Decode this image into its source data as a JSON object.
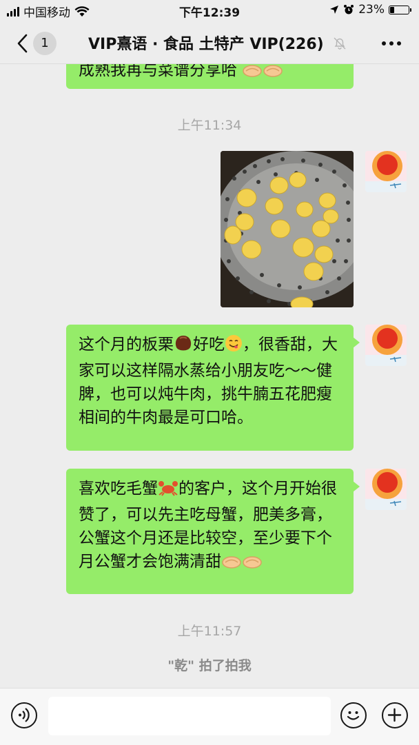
{
  "status_bar": {
    "carrier": "中国移动",
    "time": "下午12:39",
    "battery": "23%"
  },
  "nav": {
    "back_count": "1",
    "title": "VIP熹语 · 食品 土特产 VIP(226)"
  },
  "messages": {
    "partial_text": "成熟我再与菜谱分享哈",
    "timestamp_1": "上午11:34",
    "msg_1_part1": "这个月的板栗",
    "msg_1_part2": "好吃",
    "msg_1_part3": "，很香甜，大家可以这样隔水蒸给小朋友吃～～健脾，也可以炖牛肉，挑牛腩五花肥瘦相间的牛肉最是可口哈。",
    "msg_2_part1": "喜欢吃毛蟹",
    "msg_2_part2": "的客户，这个月开始很赞了，可以先主吃母蟹，肥美多膏，公蟹这个月还是比较空，至少要下个月公蟹才会饱满清甜",
    "timestamp_2": "上午11:57",
    "system_pat": "\"乾\" 拍了拍我"
  },
  "input": {
    "placeholder": ""
  },
  "colors": {
    "bubble_green": "#95ec69",
    "background": "#ededed",
    "timestamp_gray": "#a6a6a6"
  }
}
